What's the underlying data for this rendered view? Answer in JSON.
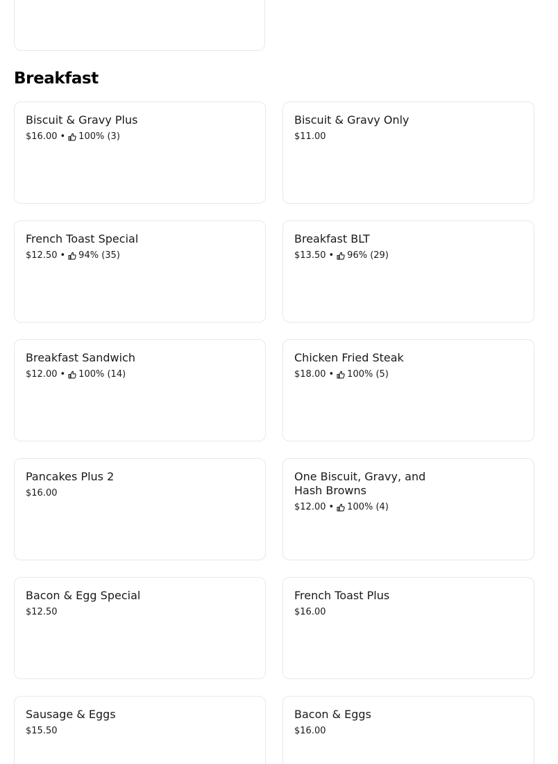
{
  "section": {
    "title": "Breakfast"
  },
  "items": [
    {
      "name": "Biscuit & Gravy Plus",
      "price": "$16.00",
      "rating": "100% (3)"
    },
    {
      "name": "Biscuit & Gravy Only",
      "price": "$11.00",
      "rating": null
    },
    {
      "name": "French Toast Special",
      "price": "$12.50",
      "rating": "94% (35)"
    },
    {
      "name": "Breakfast BLT",
      "price": "$13.50",
      "rating": "96% (29)"
    },
    {
      "name": "Breakfast Sandwich",
      "price": "$12.00",
      "rating": "100% (14)"
    },
    {
      "name": "Chicken Fried Steak",
      "price": "$18.00",
      "rating": "100% (5)"
    },
    {
      "name": "Pancakes Plus 2",
      "price": "$16.00",
      "rating": null
    },
    {
      "name": "One Biscuit, Gravy, and Hash Browns",
      "price": "$12.00",
      "rating": "100% (4)"
    },
    {
      "name": "Bacon & Egg Special",
      "price": "$12.50",
      "rating": null
    },
    {
      "name": "French Toast Plus",
      "price": "$16.00",
      "rating": null
    },
    {
      "name": "Sausage & Eggs",
      "price": "$15.50",
      "rating": null
    },
    {
      "name": "Bacon & Eggs",
      "price": "$16.00",
      "rating": null
    }
  ],
  "separator": "•",
  "icons": {
    "rating": "thumbs-up-icon"
  }
}
